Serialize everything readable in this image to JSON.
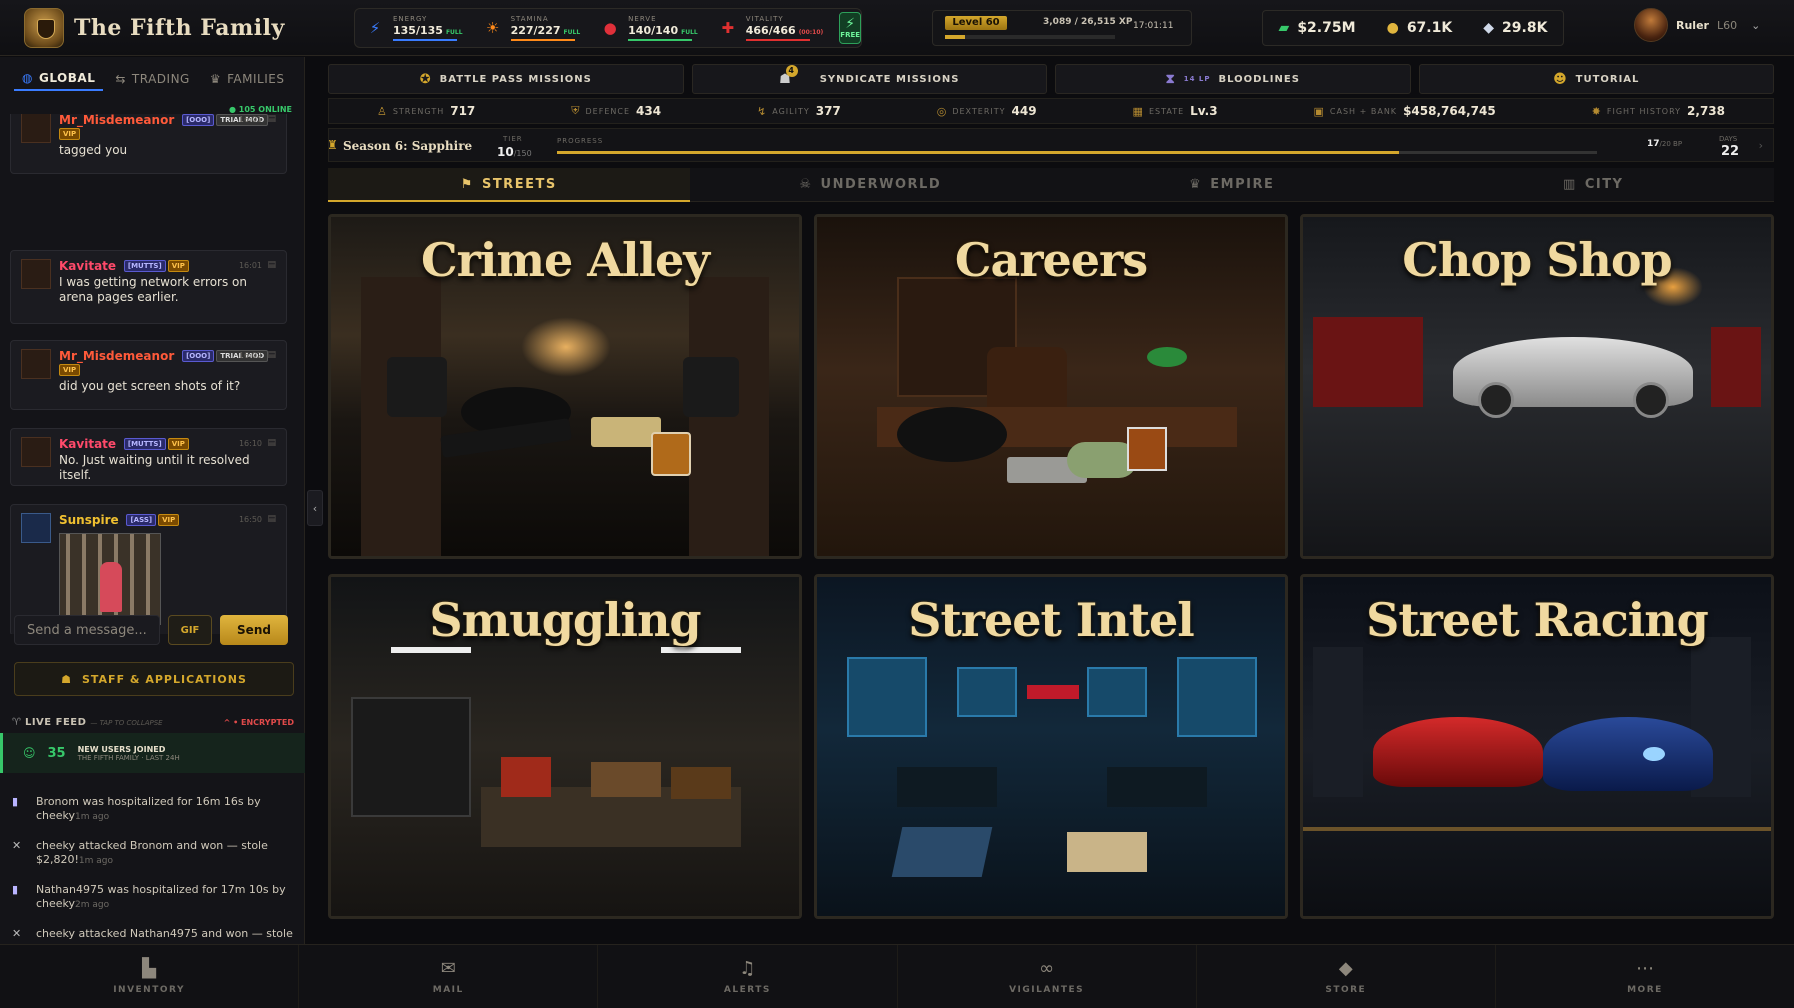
{
  "app": {
    "title": "The Fifth Family"
  },
  "header": {
    "stats": [
      {
        "label": "ENERGY",
        "value": "135/135",
        "status": "FULL",
        "icon": "lightning-icon",
        "color": "#3a7cff",
        "fill": 1.0
      },
      {
        "label": "STAMINA",
        "value": "227/227",
        "status": "FULL",
        "icon": "flame-icon",
        "color": "#ff8a1a",
        "fill": 1.0
      },
      {
        "label": "NERVE",
        "value": "140/140",
        "status": "FULL",
        "icon": "brain-icon",
        "color": "#e0303a",
        "fill": 1.0
      },
      {
        "label": "VITALITY",
        "value": "466/466",
        "status": "(00:10)",
        "icon": "heart-pulse-icon",
        "color": "#e03030",
        "fill": 1.0
      }
    ],
    "free_button": "FREE",
    "level": {
      "label": "Level 60",
      "xp": "3,089 / 26,515 XP",
      "clock": "17:01:11",
      "progress": 0.12
    },
    "currencies": [
      {
        "value": "$2.75M",
        "icon": "cash-icon"
      },
      {
        "value": "67.1K",
        "icon": "coin-icon"
      },
      {
        "value": "29.8K",
        "icon": "diamond-icon"
      }
    ],
    "user": {
      "name": "Ruler",
      "level": "L60"
    }
  },
  "sidebar": {
    "tabs": [
      {
        "label": "GLOBAL",
        "icon": "globe-icon",
        "active": true
      },
      {
        "label": "TRADING",
        "icon": "trade-icon",
        "active": false
      },
      {
        "label": "FAMILIES",
        "icon": "crown-icon",
        "active": false
      }
    ],
    "online": "105 ONLINE",
    "messages": [
      {
        "name": "Mr_Misdemeanor",
        "name_color": "#ff5a3a",
        "tags": [
          {
            "t": "[OOO]",
            "c": "blue"
          },
          {
            "t": "TRIAL MOD",
            "c": "gray"
          },
          {
            "t": "VIP",
            "c": "vip"
          }
        ],
        "time": "16:01",
        "text": "tagged you"
      },
      {
        "name": "Kavitate",
        "name_color": "#ff4a6a",
        "tags": [
          {
            "t": "[MUTTS]",
            "c": "blue"
          },
          {
            "t": "VIP",
            "c": "vip"
          }
        ],
        "time": "16:01",
        "text": "I was getting network errors on arena pages earlier."
      },
      {
        "name": "Mr_Misdemeanor",
        "name_color": "#ff5a3a",
        "tags": [
          {
            "t": "[OOO]",
            "c": "blue"
          },
          {
            "t": "TRIAL MOD",
            "c": "gray"
          },
          {
            "t": "VIP",
            "c": "vip"
          }
        ],
        "time": "16:02",
        "text": "did you get screen shots of it?"
      },
      {
        "name": "Kavitate",
        "name_color": "#ff4a6a",
        "tags": [
          {
            "t": "[MUTTS]",
            "c": "blue"
          },
          {
            "t": "VIP",
            "c": "vip"
          }
        ],
        "time": "16:10",
        "text": "No. Just waiting until it resolved itself."
      },
      {
        "name": "Sunspire",
        "name_color": "#f0c030",
        "tags": [
          {
            "t": "[ASS]",
            "c": "blue"
          },
          {
            "t": "VIP",
            "c": "vip"
          }
        ],
        "time": "16:50",
        "text": ""
      }
    ],
    "composer": {
      "placeholder": "Send a message...",
      "gif": "GIF",
      "send": "Send"
    },
    "staff_button": "STAFF & APPLICATIONS",
    "feed": {
      "title": "LIVE FEED",
      "subtitle": "— TAP TO COLLAPSE",
      "encrypted": "• ENCRYPTED",
      "new_users": {
        "count": "35",
        "line1": "NEW USERS JOINED",
        "line2": "THE FIFTH FAMILY · LAST 24H"
      },
      "items": [
        {
          "icon": "hospital-icon",
          "text": "Bronom was hospitalized for 16m 16s by cheeky",
          "ago": "1m ago"
        },
        {
          "icon": "swords-icon",
          "text": "cheeky attacked Bronom and won — stole $2,820!",
          "ago": "1m ago"
        },
        {
          "icon": "hospital-icon",
          "text": "Nathan4975 was hospitalized for 17m 10s by cheeky",
          "ago": "2m ago"
        },
        {
          "icon": "swords-icon",
          "text": "cheeky attacked Nathan4975 and won — stole",
          "ago": ""
        }
      ]
    }
  },
  "main": {
    "missions": [
      {
        "label": "BATTLE PASS MISSIONS",
        "icon": "medal-icon"
      },
      {
        "label": "SYNDICATE MISSIONS",
        "icon": "syndicate-icon",
        "badge": "4"
      },
      {
        "label": "BLOODLINES",
        "icon": "hourglass-icon",
        "prefix": "14 LP"
      },
      {
        "label": "TUTORIAL",
        "icon": "person-icon"
      }
    ],
    "stats": [
      {
        "label": "STRENGTH",
        "value": "717",
        "icon": "strength-icon"
      },
      {
        "label": "DEFENCE",
        "value": "434",
        "icon": "shield-icon"
      },
      {
        "label": "AGILITY",
        "value": "377",
        "icon": "runner-icon"
      },
      {
        "label": "DEXTERITY",
        "value": "449",
        "icon": "target-icon"
      },
      {
        "label": "ESTATE",
        "value": "Lv.3",
        "icon": "building-icon"
      },
      {
        "label": "CASH + BANK",
        "value": "$458,764,745",
        "icon": "wallet-icon"
      },
      {
        "label": "FIGHT HISTORY",
        "value": "2,738",
        "icon": "fist-icon"
      }
    ],
    "season": {
      "name": "Season 6: Sapphire",
      "tier_label": "TIER",
      "tier": "10",
      "tier_max": "/150",
      "progress_label": "PROGRESS",
      "progress": 0.81,
      "bp": "17",
      "bp_max": "/20 BP",
      "days_label": "DAYS",
      "days": "22"
    },
    "zones": [
      {
        "label": "STREETS",
        "icon": "flag-icon",
        "active": true
      },
      {
        "label": "UNDERWORLD",
        "icon": "skull-icon",
        "active": false
      },
      {
        "label": "EMPIRE",
        "icon": "crown-icon",
        "active": false
      },
      {
        "label": "CITY",
        "icon": "city-icon",
        "active": false
      }
    ],
    "cards": [
      {
        "title": "Crime Alley"
      },
      {
        "title": "Careers"
      },
      {
        "title": "Chop Shop"
      },
      {
        "title": "Smuggling"
      },
      {
        "title": "Street Intel"
      },
      {
        "title": "Street Racing"
      }
    ]
  },
  "bottom_nav": [
    {
      "label": "INVENTORY",
      "icon": "backpack-icon"
    },
    {
      "label": "MAIL",
      "icon": "mail-icon"
    },
    {
      "label": "ALERTS",
      "icon": "bell-icon"
    },
    {
      "label": "VIGILANTES",
      "icon": "mask-icon"
    },
    {
      "label": "STORE",
      "icon": "gem-icon"
    },
    {
      "label": "MORE",
      "icon": "dots-icon"
    }
  ]
}
